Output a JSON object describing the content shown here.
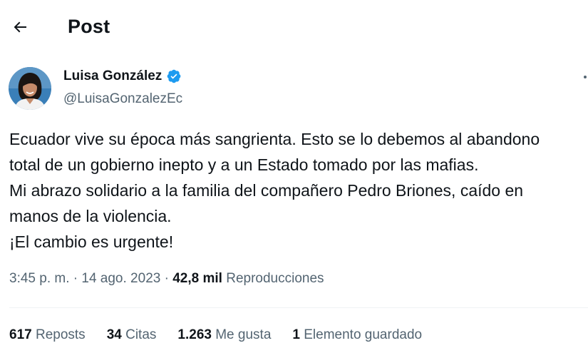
{
  "header": {
    "title": "Post",
    "back_icon": "arrow-left-icon"
  },
  "author": {
    "name": "Luisa González",
    "handle": "@LuisaGonzalezEc",
    "verified_icon": "verified-badge-icon",
    "verified_color": "#1d9bf0"
  },
  "tweet": {
    "lines": [
      "Ecuador vive su época más sangrienta. Esto se lo debemos al abandono",
      "total de un gobierno inepto y a un Estado tomado por las mafias.",
      "Mi abrazo solidario a la familia del compañero Pedro Briones, caído en",
      "manos de la violencia.",
      "¡El cambio es urgente!"
    ]
  },
  "meta": {
    "time": "3:45 p. m.",
    "separator": "·",
    "date": "14 ago. 2023",
    "views_count": "42,8 mil",
    "views_label": "Reproducciones"
  },
  "stats": {
    "reposts_count": "617",
    "reposts_label": "Reposts",
    "quotes_count": "34",
    "quotes_label": "Citas",
    "likes_count": "1.263",
    "likes_label": "Me gusta",
    "bookmarks_count": "1",
    "bookmarks_label": "Elemento guardado"
  },
  "colors": {
    "text_primary": "#0f1419",
    "text_secondary": "#536471",
    "accent": "#1d9bf0",
    "divider": "#eff3f4"
  }
}
